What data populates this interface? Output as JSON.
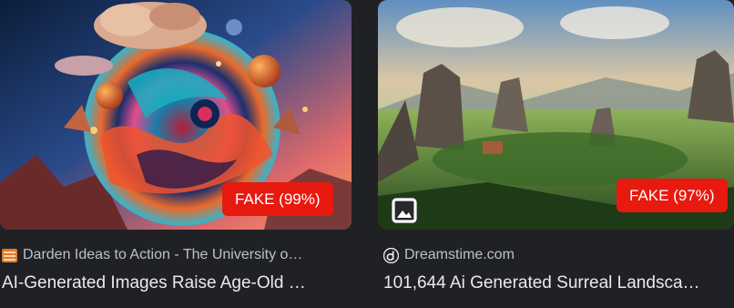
{
  "results": [
    {
      "badge": "FAKE (99%)",
      "source_icon": "darden-favicon",
      "source": "Darden Ideas to Action - The University o…",
      "title": "AI-Generated Images Raise Age-Old …",
      "image_subject": "surreal cosmic planet with swirling colors"
    },
    {
      "badge": "FAKE (97%)",
      "source_icon": "dreamstime-favicon",
      "source": "Dreamstime.com",
      "title": "101,644 Ai Generated Surreal Landsca…",
      "image_subject": "rocky pillars in green valley landscape",
      "overlay_icon": "image-icon"
    }
  ],
  "colors": {
    "background": "#202124",
    "badge": "#e8190f",
    "source_text": "#bdc1c6",
    "title_text": "#e8eaed"
  }
}
